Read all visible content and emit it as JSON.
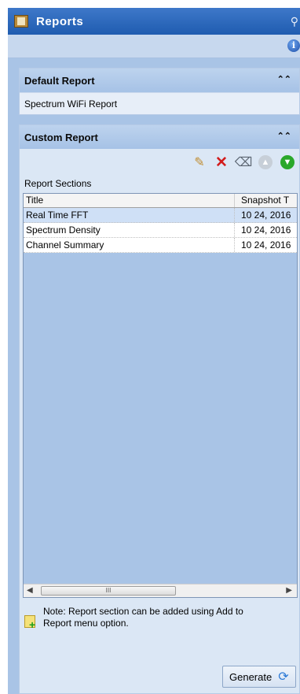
{
  "window": {
    "title": "Reports"
  },
  "default_report": {
    "header": "Default Report",
    "item": "Spectrum WiFi Report"
  },
  "custom_report": {
    "header": "Custom Report",
    "sections_label": "Report Sections",
    "columns": [
      "Title",
      "Snapshot T"
    ],
    "rows": [
      {
        "title": "Real Time FFT",
        "snapshot": "10 24, 2016",
        "selected": true
      },
      {
        "title": "Spectrum Density",
        "snapshot": "10 24, 2016",
        "selected": false
      },
      {
        "title": "Channel Summary",
        "snapshot": "10 24, 2016",
        "selected": false
      }
    ],
    "scroll_thumb_glyph": "III"
  },
  "note": {
    "line1": "Note:  Report section can be added using Add to",
    "line2": "Report menu option."
  },
  "generate_label": "Generate",
  "icons": {
    "title": "reports-app-icon",
    "search": "search-icon",
    "info": "info-icon",
    "collapse": "double-chevron-up-icon",
    "edit": "pencil-icon",
    "delete": "delete-icon",
    "clear": "eraser-icon",
    "up": "move-up-icon",
    "down": "move-down-icon",
    "note": "add-note-icon",
    "refresh": "refresh-icon"
  },
  "colors": {
    "title_bar": "#2a67bd",
    "panel_bg": "#a9c4e6",
    "selected_row": "#cfe0f6"
  }
}
